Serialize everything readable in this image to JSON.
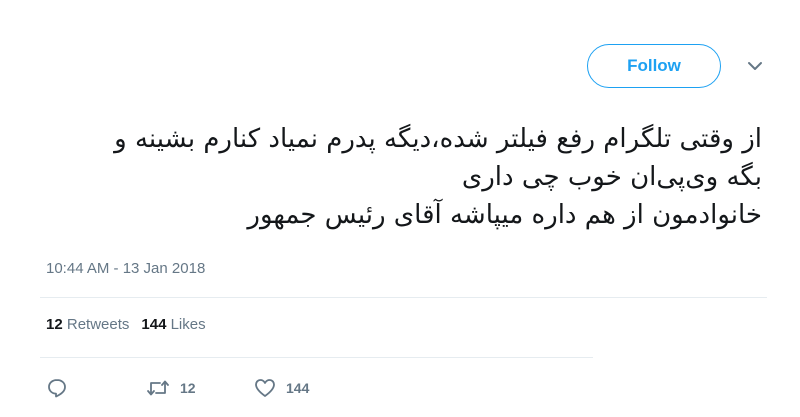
{
  "header": {
    "follow_label": "Follow"
  },
  "tweet": {
    "lines": [
      "از وقتی تلگرام رفع فیلتر شده،دیگه پدرم نمیاد کنارم بشینه و",
      "بگه وی‌پی‌ان خوب چی داری",
      "خانوادمون از هم داره میپاشه آقای رئیس جمهور"
    ],
    "timestamp": "10:44 AM - 13 Jan 2018"
  },
  "stats": {
    "retweets_count": "12",
    "retweets_label": "Retweets",
    "likes_count": "144",
    "likes_label": "Likes"
  },
  "actions": {
    "reply_icon": "reply-icon",
    "retweet_icon": "retweet-icon",
    "retweet_count": "12",
    "like_icon": "heart-icon",
    "like_count": "144"
  },
  "colors": {
    "accent": "#1da1f2",
    "text": "#14171a",
    "muted": "#657786",
    "divider": "#e6ecf0"
  }
}
